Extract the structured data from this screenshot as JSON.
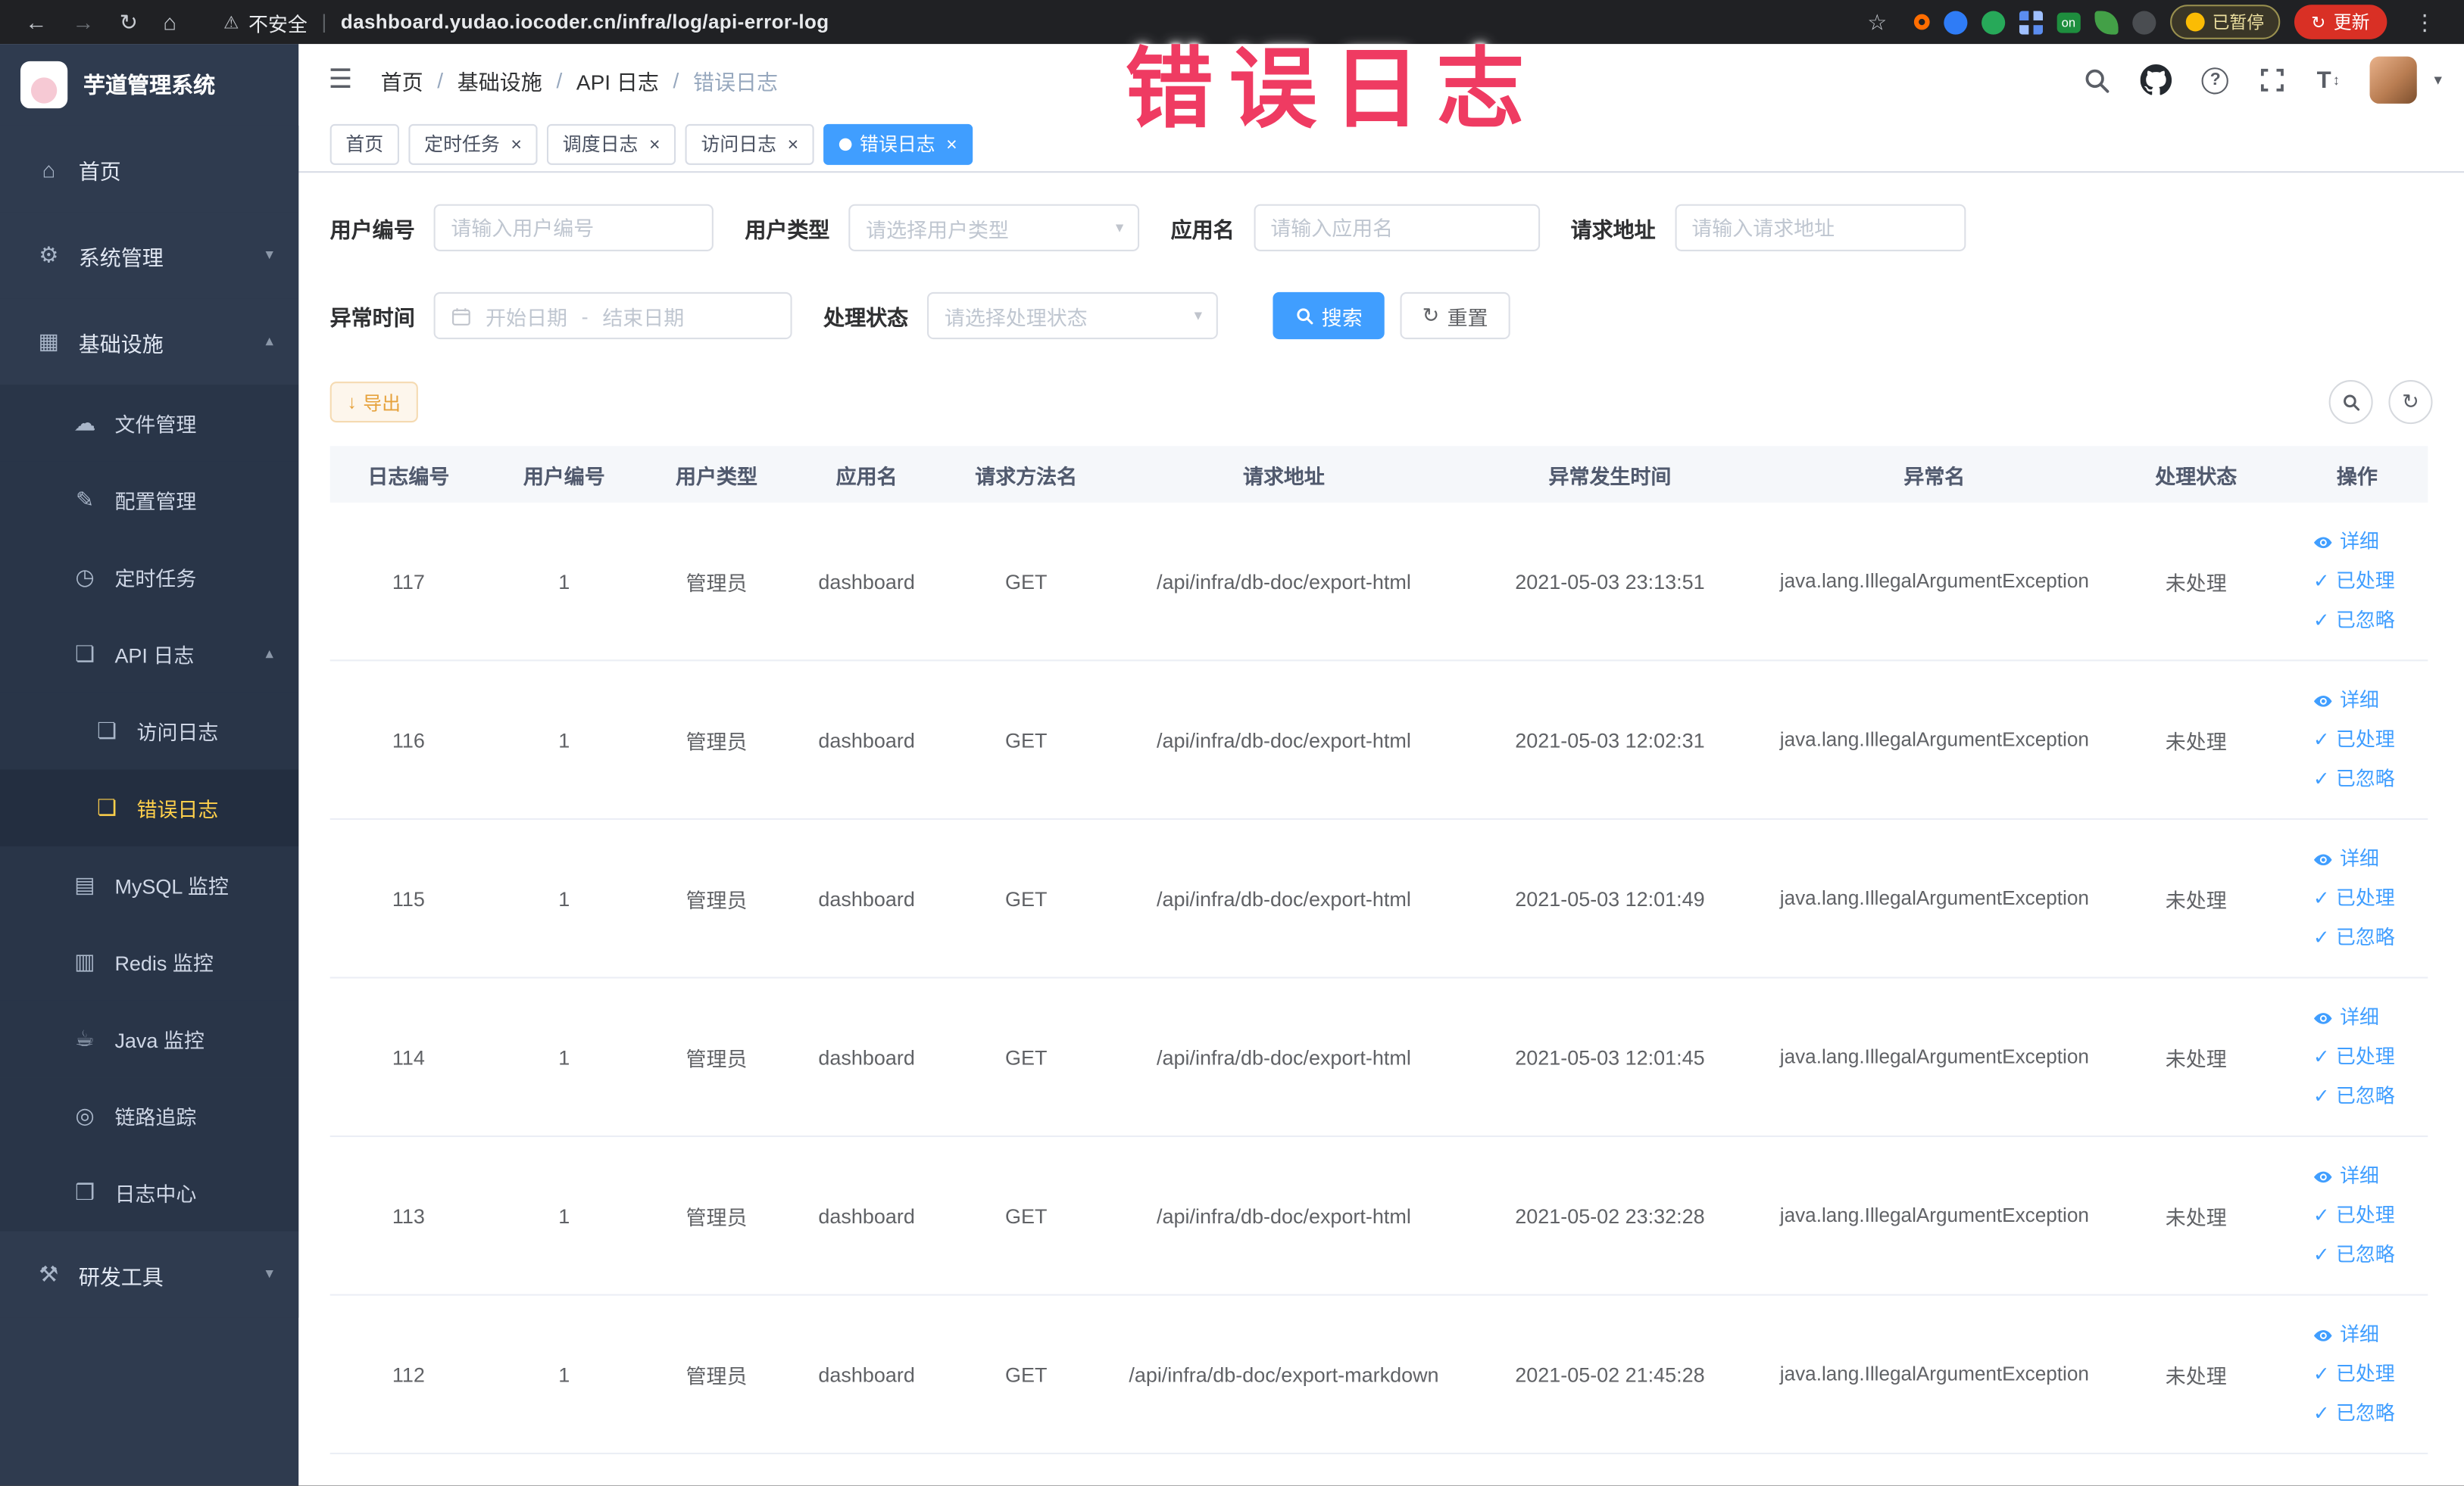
{
  "browser": {
    "security_label": "不安全",
    "url": "dashboard.yudao.iocoder.cn/infra/log/api-error-log",
    "paused_label": "已暂停",
    "update_label": "更新",
    "nav_icons": [
      "back-icon",
      "forward-icon",
      "reload-icon",
      "home-icon"
    ],
    "extensions": [
      {
        "name": "orange-ring-extension"
      },
      {
        "name": "blue-drop-extension"
      },
      {
        "name": "green-circle-extension"
      },
      {
        "name": "blue-grid-extension"
      },
      {
        "name": "green-on-extension",
        "text": "on"
      },
      {
        "name": "green-leaf-extension"
      },
      {
        "name": "dark-paw-extension"
      }
    ]
  },
  "annotation": {
    "text": "错误日志"
  },
  "sidebar": {
    "logo_title": "芋道管理系统",
    "items": [
      {
        "name": "home",
        "label": "首页",
        "icon": "home",
        "level": 1
      },
      {
        "name": "system-management",
        "label": "系统管理",
        "icon": "gear",
        "level": 1,
        "arrow": "down"
      },
      {
        "name": "infrastructure",
        "label": "基础设施",
        "icon": "grid",
        "level": 1,
        "arrow": "up"
      },
      {
        "name": "file-management",
        "label": "文件管理",
        "icon": "cloud",
        "level": 2
      },
      {
        "name": "config-management",
        "label": "配置管理",
        "icon": "pencil",
        "level": 2
      },
      {
        "name": "scheduled-tasks",
        "label": "定时任务",
        "icon": "timer",
        "level": 2
      },
      {
        "name": "api-log",
        "label": "API 日志",
        "icon": "doc",
        "level": 2,
        "arrow": "up"
      },
      {
        "name": "access-log",
        "label": "访问日志",
        "icon": "doc",
        "level": 3
      },
      {
        "name": "error-log",
        "label": "错误日志",
        "icon": "doc",
        "level": 3,
        "active": true
      },
      {
        "name": "mysql-monitor",
        "label": "MySQL 监控",
        "icon": "table",
        "level": 2
      },
      {
        "name": "redis-monitor",
        "label": "Redis 监控",
        "icon": "db",
        "level": 2
      },
      {
        "name": "java-monitor",
        "label": "Java 监控",
        "icon": "coffee",
        "level": 2
      },
      {
        "name": "trace",
        "label": "链路追踪",
        "icon": "target",
        "level": 2
      },
      {
        "name": "log-center",
        "label": "日志中心",
        "icon": "log",
        "level": 2
      },
      {
        "name": "dev-tools",
        "label": "研发工具",
        "icon": "tools",
        "level": 1,
        "arrow": "down"
      }
    ]
  },
  "header": {
    "breadcrumb": [
      "首页",
      "基础设施",
      "API 日志",
      "错误日志"
    ],
    "icons": [
      "search-icon",
      "github-icon",
      "help-icon",
      "fullscreen-icon",
      "font-size-icon",
      "avatar",
      "chevron-down-icon"
    ]
  },
  "tabs": [
    {
      "name": "home",
      "label": "首页",
      "closable": false,
      "active": false
    },
    {
      "name": "scheduled-tasks",
      "label": "定时任务",
      "closable": true,
      "active": false
    },
    {
      "name": "schedule-log",
      "label": "调度日志",
      "closable": true,
      "active": false
    },
    {
      "name": "access-log",
      "label": "访问日志",
      "closable": true,
      "active": false
    },
    {
      "name": "error-log",
      "label": "错误日志",
      "closable": true,
      "active": true
    }
  ],
  "filters": {
    "user_id": {
      "label": "用户编号",
      "placeholder": "请输入用户编号"
    },
    "user_type": {
      "label": "用户类型",
      "placeholder": "请选择用户类型"
    },
    "app_name": {
      "label": "应用名",
      "placeholder": "请输入应用名"
    },
    "request_url": {
      "label": "请求地址",
      "placeholder": "请输入请求地址"
    },
    "exception_time": {
      "label": "异常时间",
      "start_placeholder": "开始日期",
      "separator": "-",
      "end_placeholder": "结束日期"
    },
    "process_status": {
      "label": "处理状态",
      "placeholder": "请选择处理状态"
    },
    "search_label": "搜索",
    "reset_label": "重置"
  },
  "toolbar": {
    "export_label": "导出"
  },
  "table": {
    "columns": [
      "日志编号",
      "用户编号",
      "用户类型",
      "应用名",
      "请求方法名",
      "请求地址",
      "异常发生时间",
      "异常名",
      "处理状态",
      "操作"
    ],
    "row_actions": [
      "详细",
      "已处理",
      "已忽略"
    ],
    "rows": [
      {
        "id": "117",
        "user_id": "1",
        "user_type": "管理员",
        "app": "dashboard",
        "method": "GET",
        "url": "/api/infra/db-doc/export-html",
        "time": "2021-05-03 23:13:51",
        "exception": "java.lang.IllegalArgumentException",
        "status": "未处理"
      },
      {
        "id": "116",
        "user_id": "1",
        "user_type": "管理员",
        "app": "dashboard",
        "method": "GET",
        "url": "/api/infra/db-doc/export-html",
        "time": "2021-05-03 12:02:31",
        "exception": "java.lang.IllegalArgumentException",
        "status": "未处理"
      },
      {
        "id": "115",
        "user_id": "1",
        "user_type": "管理员",
        "app": "dashboard",
        "method": "GET",
        "url": "/api/infra/db-doc/export-html",
        "time": "2021-05-03 12:01:49",
        "exception": "java.lang.IllegalArgumentException",
        "status": "未处理"
      },
      {
        "id": "114",
        "user_id": "1",
        "user_type": "管理员",
        "app": "dashboard",
        "method": "GET",
        "url": "/api/infra/db-doc/export-html",
        "time": "2021-05-03 12:01:45",
        "exception": "java.lang.IllegalArgumentException",
        "status": "未处理"
      },
      {
        "id": "113",
        "user_id": "1",
        "user_type": "管理员",
        "app": "dashboard",
        "method": "GET",
        "url": "/api/infra/db-doc/export-html",
        "time": "2021-05-02 23:32:28",
        "exception": "java.lang.IllegalArgumentException",
        "status": "未处理"
      },
      {
        "id": "112",
        "user_id": "1",
        "user_type": "管理员",
        "app": "dashboard",
        "method": "GET",
        "url": "/api/infra/db-doc/export-markdown",
        "time": "2021-05-02 21:45:28",
        "exception": "java.lang.IllegalArgumentException",
        "status": "未处理"
      }
    ]
  }
}
